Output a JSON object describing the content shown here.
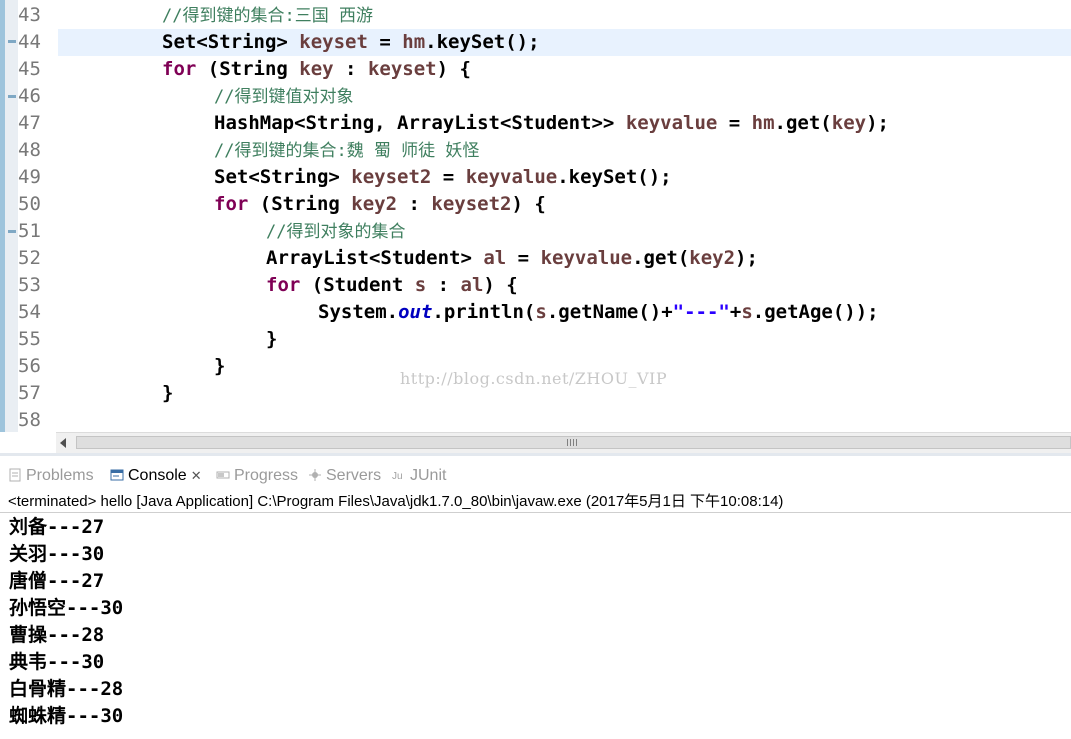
{
  "editor": {
    "line_numbers": [
      "43",
      "44",
      "45",
      "46",
      "47",
      "48",
      "49",
      "50",
      "51",
      "52",
      "53",
      "54",
      "55",
      "56",
      "57",
      "58"
    ],
    "lines": [
      {
        "segs": [
          [
            "cmt",
            "//得到键的集合:三国 西游"
          ]
        ]
      },
      {
        "segs": [
          [
            "n",
            "Set<String> "
          ],
          [
            "var",
            "keyset"
          ],
          [
            "n",
            " = "
          ],
          [
            "var",
            "hm"
          ],
          [
            "n",
            ".keySet();"
          ]
        ]
      },
      {
        "segs": [
          [
            "kw",
            "for"
          ],
          [
            "n",
            " (String "
          ],
          [
            "var",
            "key"
          ],
          [
            "n",
            " : "
          ],
          [
            "var",
            "keyset"
          ],
          [
            "n",
            ") {"
          ]
        ]
      },
      {
        "segs": [
          [
            "cmt",
            "//得到键值对对象"
          ]
        ]
      },
      {
        "segs": [
          [
            "n",
            "HashMap<String, ArrayList<Student>> "
          ],
          [
            "var",
            "keyvalue"
          ],
          [
            "n",
            " = "
          ],
          [
            "var",
            "hm"
          ],
          [
            "n",
            ".get("
          ],
          [
            "var",
            "key"
          ],
          [
            "n",
            ");"
          ]
        ]
      },
      {
        "segs": [
          [
            "cmt",
            "//得到键的集合:魏 蜀 师徒 妖怪"
          ]
        ]
      },
      {
        "segs": [
          [
            "n",
            "Set<String> "
          ],
          [
            "var",
            "keyset2"
          ],
          [
            "n",
            " = "
          ],
          [
            "var",
            "keyvalue"
          ],
          [
            "n",
            ".keySet();"
          ]
        ]
      },
      {
        "segs": [
          [
            "kw",
            "for"
          ],
          [
            "n",
            " (String "
          ],
          [
            "var",
            "key2"
          ],
          [
            "n",
            " : "
          ],
          [
            "var",
            "keyset2"
          ],
          [
            "n",
            ") {"
          ]
        ]
      },
      {
        "segs": [
          [
            "cmt",
            "//得到对象的集合"
          ]
        ]
      },
      {
        "segs": [
          [
            "n",
            "ArrayList<Student> "
          ],
          [
            "var",
            "al"
          ],
          [
            "n",
            " = "
          ],
          [
            "var",
            "keyvalue"
          ],
          [
            "n",
            ".get("
          ],
          [
            "var",
            "key2"
          ],
          [
            "n",
            ");"
          ]
        ]
      },
      {
        "segs": [
          [
            "kw",
            "for"
          ],
          [
            "n",
            " (Student "
          ],
          [
            "var",
            "s"
          ],
          [
            "n",
            " : "
          ],
          [
            "var",
            "al"
          ],
          [
            "n",
            ") {"
          ]
        ]
      },
      {
        "segs": [
          [
            "n",
            "System."
          ],
          [
            "fld",
            "out"
          ],
          [
            "n",
            ".println("
          ],
          [
            "var",
            "s"
          ],
          [
            "n",
            ".getName()+"
          ],
          [
            "str",
            "\"---\""
          ],
          [
            "n",
            "+"
          ],
          [
            "var",
            "s"
          ],
          [
            "n",
            ".getAge());"
          ]
        ]
      },
      {
        "segs": [
          [
            "n",
            "}"
          ]
        ]
      },
      {
        "segs": [
          [
            "n",
            "}"
          ]
        ]
      },
      {
        "segs": [
          [
            "n",
            "}"
          ]
        ]
      },
      {
        "segs": []
      }
    ],
    "watermark": "http://blog.csdn.net/ZHOU_VIP"
  },
  "panel": {
    "tabs": [
      {
        "label": "Problems",
        "icon": "problems-icon"
      },
      {
        "label": "Console",
        "icon": "console-icon",
        "active": true
      },
      {
        "label": "Progress",
        "icon": "progress-icon"
      },
      {
        "label": "Servers",
        "icon": "servers-icon"
      },
      {
        "label": "JUnit",
        "icon": "junit-icon"
      }
    ],
    "close_glyph": "✕",
    "status": "<terminated> hello [Java Application] C:\\Program Files\\Java\\jdk1.7.0_80\\bin\\javaw.exe (2017年5月1日 下午10:08:14)",
    "output": [
      "刘备---27",
      "关羽---30",
      "唐僧---27",
      "孙悟空---30",
      "曹操---28",
      "典韦---30",
      "白骨精---28",
      "蜘蛛精---30"
    ]
  },
  "colors": {
    "keyword": "#7f0055",
    "variable": "#6a3e3e",
    "field": "#0000c0",
    "string": "#2a00ff",
    "comment": "#3f7f5f",
    "current_line": "#e8f2fe"
  }
}
